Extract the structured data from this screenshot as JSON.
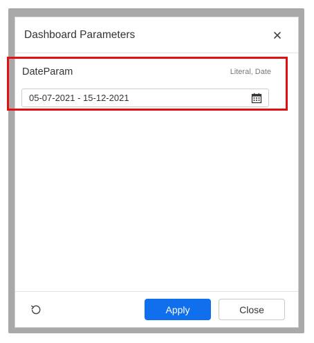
{
  "dialog": {
    "title": "Dashboard Parameters"
  },
  "parameter": {
    "name": "DateParam",
    "type": "Literal, Date",
    "value": "05-07-2021 - 15-12-2021"
  },
  "footer": {
    "apply_label": "Apply",
    "close_label": "Close"
  },
  "icons": {
    "close": "close-icon",
    "calendar": "calendar-icon",
    "reset": "reset-icon"
  },
  "colors": {
    "accent": "#0f6fed",
    "highlight_border": "#e01010"
  }
}
